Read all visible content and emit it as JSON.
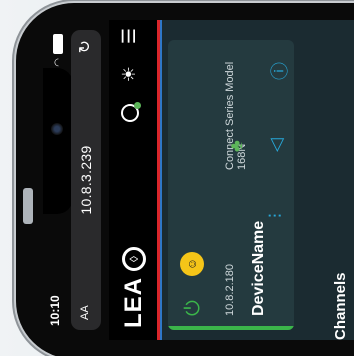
{
  "browser": {
    "time": "10:10",
    "text_size": "AA",
    "url": "10.8.3.239",
    "reload_icon": "↻"
  },
  "app": {
    "logo": "LEA",
    "logo_mark": "◊",
    "menu_icon": "☰",
    "brightness_icon": "☀"
  },
  "device": {
    "name": "DeviceName",
    "ip": "10.8.2.180",
    "model": "Connect Series Model 168N",
    "power_icon": "⏻",
    "status_emoji": "☺"
  },
  "sections": {
    "channels": "Channels"
  },
  "colors": {
    "accent_green": "#3bb54a",
    "accent_blue": "#27a7d8",
    "header_red": "#d9262b",
    "header_blue": "#2f77c8",
    "panel_bg": "#1b2b31"
  }
}
